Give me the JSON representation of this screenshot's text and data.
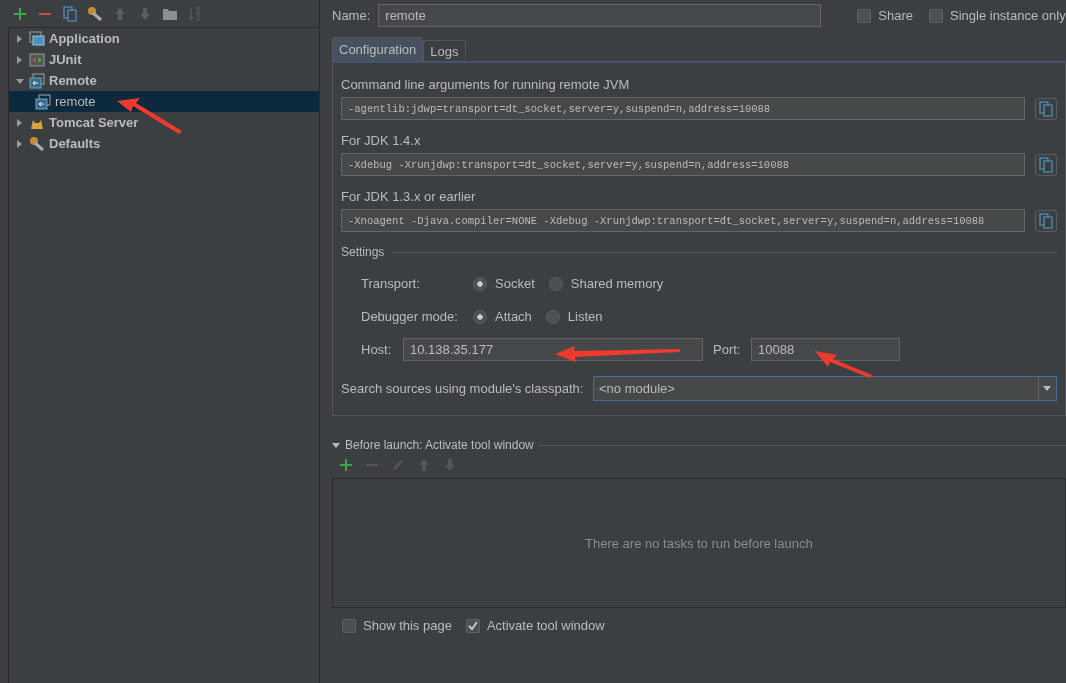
{
  "tree": [
    {
      "label": "Application",
      "kind": "application",
      "expanded": false,
      "selected": false
    },
    {
      "label": "JUnit",
      "kind": "junit",
      "expanded": false,
      "selected": false
    },
    {
      "label": "Remote",
      "kind": "remote",
      "expanded": true,
      "selected": false,
      "children": [
        {
          "label": "remote",
          "kind": "remote",
          "selected": true
        }
      ]
    },
    {
      "label": "Tomcat Server",
      "kind": "tomcat",
      "expanded": false,
      "selected": false
    },
    {
      "label": "Defaults",
      "kind": "defaults",
      "expanded": false,
      "selected": false
    }
  ],
  "name": {
    "label": "Name:",
    "value": "remote"
  },
  "options": [
    {
      "label": "Share",
      "checked": false
    },
    {
      "label": "Single instance only",
      "checked": false
    }
  ],
  "tabs": [
    {
      "label": "Configuration",
      "selected": true
    },
    {
      "label": "Logs",
      "selected": false
    }
  ],
  "arguments": [
    {
      "label": "Command line arguments for running remote JVM",
      "value": "-agentlib:jdwp=transport=dt_socket,server=y,suspend=n,address=10088"
    },
    {
      "label": "For JDK 1.4.x",
      "value": "-Xdebug -Xrunjdwp:transport=dt_socket,server=y,suspend=n,address=10088"
    },
    {
      "label": "For JDK 1.3.x or earlier",
      "value": "-Xnoagent -Djava.compiler=NONE -Xdebug -Xrunjdwp:transport=dt_socket,server=y,suspend=n,address=10088"
    }
  ],
  "settings": {
    "title": "Settings",
    "radio_groups": [
      {
        "label": "Transport:",
        "options": [
          {
            "label": "Socket",
            "selected": true
          },
          {
            "label": "Shared memory",
            "selected": false
          }
        ]
      },
      {
        "label": "Debugger mode:",
        "options": [
          {
            "label": "Attach",
            "selected": true
          },
          {
            "label": "Listen",
            "selected": false
          }
        ]
      }
    ],
    "host": {
      "label": "Host:",
      "value": "10.138.35.177"
    },
    "port": {
      "label": "Port:",
      "value": "10088"
    },
    "module": {
      "label": "Search sources using module's classpath:",
      "value": "<no module>"
    }
  },
  "before_launch": {
    "title": "Before launch: Activate tool window",
    "expanded": true,
    "empty_text": "There are no tasks to run before launch"
  },
  "footer": [
    {
      "label": "Show this page",
      "checked": false
    },
    {
      "label": "Activate tool window",
      "checked": true
    }
  ]
}
